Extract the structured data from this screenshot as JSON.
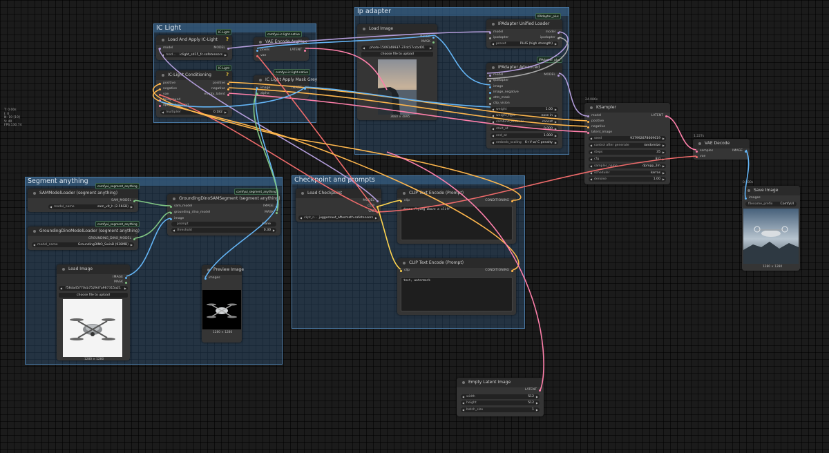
{
  "stats": [
    "T: 0.00s",
    "I: 0",
    "N: 19 [19]",
    "V: 40",
    "FPS:130.74"
  ],
  "groups": {
    "ic_light": "IC Light",
    "ip_adapter": "Ip adapter",
    "segment": "Segment anything",
    "checkpoint": "Checkpoint and prompts"
  },
  "nodes": {
    "ic_load": {
      "title": "Load And Apply IC-Light",
      "badge": "IC-Light",
      "out": "MODEL",
      "in": "model",
      "widget_label": "mod...",
      "widget_value": "iclight_sd15_fc.safetensors"
    },
    "ic_cond": {
      "title": "IC-Light Conditioning",
      "badge": "IC-Light",
      "inputs": [
        "positive",
        "negative",
        "vae",
        "foreground",
        "opt_background"
      ],
      "outputs": [
        "positive",
        "negative",
        "empty_latent"
      ],
      "widget_label": "multiplier",
      "widget_value": "0.182"
    },
    "vae_argmax": {
      "title": "VAE Encode ArgMax",
      "badge": "comfyui-ic-light-native",
      "inputs": [
        "pixels",
        "vae"
      ],
      "out": "LATENT"
    },
    "mask_grey": {
      "title": "IC Light Apply Mask Grey",
      "badge": "comfyui-ic-light-native",
      "inputs": [
        "image",
        "alpha"
      ],
      "out": "IMAGE"
    },
    "load_image_top": {
      "title": "Load Image",
      "outputs": [
        "IMAGE",
        "MASK"
      ],
      "widget_value": "photo-1509149937-37dc57ccbd01",
      "upload": "choose file to upload",
      "caption": "3660 × 4895"
    },
    "ipa_unified": {
      "title": "IPAdapter Unified Loader",
      "badge": "IPAdapter_plus",
      "inputs": [
        "model",
        "ipadapter"
      ],
      "outputs": [
        "model",
        "ipadapter"
      ],
      "widget_label": "preset",
      "widget_value": "PLUS (high strength)"
    },
    "ipa_advanced": {
      "title": "IPAdapter Advanced",
      "badge": "IPAdapter_plus",
      "out": "MODEL",
      "inputs": [
        "model",
        "ipadapter",
        "image",
        "image_negative",
        "attn_mask",
        "clip_vision"
      ],
      "widgets": [
        {
          "label": "weight",
          "value": "1.00"
        },
        {
          "label": "weight_type",
          "value": "ease in"
        },
        {
          "label": "combine_embeds",
          "value": "concat"
        },
        {
          "label": "start_at",
          "value": "0.000"
        },
        {
          "label": "end_at",
          "value": "1.000"
        },
        {
          "label": "embeds_scaling",
          "value": "K+V w/ C penalty"
        }
      ]
    },
    "ksampler": {
      "title": "KSampler",
      "timing": "24.086s",
      "out": "LATENT",
      "inputs": [
        "model",
        "positive",
        "negative",
        "latent_image"
      ],
      "widgets": [
        {
          "label": "seed",
          "value": "937992878669619"
        },
        {
          "label": "control after generate",
          "value": "randomize"
        },
        {
          "label": "steps",
          "value": "35"
        },
        {
          "label": "cfg",
          "value": "8.0"
        },
        {
          "label": "sampler_name",
          "value": "dpmpp_2m"
        },
        {
          "label": "scheduler",
          "value": "karras"
        },
        {
          "label": "denoise",
          "value": "1.00"
        }
      ]
    },
    "vae_decode": {
      "title": "VAE Decode",
      "timing": "1.227s",
      "inputs": [
        "samples",
        "vae"
      ],
      "out": "IMAGE"
    },
    "save_image": {
      "title": "Save Image",
      "timing": "0.580s",
      "in": "images",
      "widget_label": "filename_prefix",
      "widget_value": "ComfyUI",
      "caption": "1280 × 1280"
    },
    "sam_loader": {
      "title": "SAMModelLoader (segment anything)",
      "badge": "comfyui_segment_anything",
      "out": "SAM_MODEL",
      "widget_label": "model_name",
      "widget_value": "sam_vit_h (2.56GB)"
    },
    "gdino_loader": {
      "title": "GroundingDinoModelLoader (segment anything)",
      "badge": "comfyui_segment_anything",
      "out": "GROUNDING_DINO_MODEL",
      "widget_label": "model_name",
      "widget_value": "GroundingDINO_SwinB (938MB)"
    },
    "gdino_sam": {
      "title": "GroundingDinoSAMSegment (segment anything)",
      "badge": "comfyui_segment_anything",
      "inputs": [
        "sam_model",
        "grounding_dino_model",
        "image"
      ],
      "outputs": [
        "IMAGE",
        "MASK"
      ],
      "widgets": [
        {
          "label": "prompt",
          "value": "drone"
        },
        {
          "label": "threshold",
          "value": "0.30"
        }
      ]
    },
    "load_image_bottom": {
      "title": "Load Image",
      "outputs": [
        "IMAGE",
        "MASK"
      ],
      "widget_value": "f56da45770cb7529d7a967315a21",
      "upload": "choose file to upload",
      "caption": "1280 × 1280"
    },
    "preview_image": {
      "title": "Preview Image",
      "in": "images",
      "caption": "1280 × 1280"
    },
    "load_checkpoint": {
      "title": "Load Checkpoint",
      "outputs": [
        "MODEL",
        "CLIP",
        "VAE"
      ],
      "widget_label": "ckpt_n...",
      "widget_value": "juggernaut_aftermath.safetensors"
    },
    "clip_pos": {
      "title": "CLIP Text Encode (Prompt)",
      "in": "clip",
      "out": "CONDITIONING",
      "text": "drone flying above a cliff"
    },
    "clip_neg": {
      "title": "CLIP Text Encode (Prompt)",
      "in": "clip",
      "out": "CONDITIONING",
      "text": "text, watermark"
    },
    "empty_latent": {
      "title": "Empty Latent Image",
      "out": "LATENT",
      "widgets": [
        {
          "label": "width",
          "value": "512"
        },
        {
          "label": "height",
          "value": "512"
        },
        {
          "label": "batch_size",
          "value": "1"
        }
      ]
    }
  },
  "colors": {
    "model": "#b39ddb",
    "clip": "#ffd54f",
    "vae": "#ef6b6b",
    "image": "#64b5f6",
    "latent": "#ff80ab",
    "conditioning": "#ffb74d",
    "mask": "#81c784",
    "ipadapter": "#aaaaaa"
  }
}
